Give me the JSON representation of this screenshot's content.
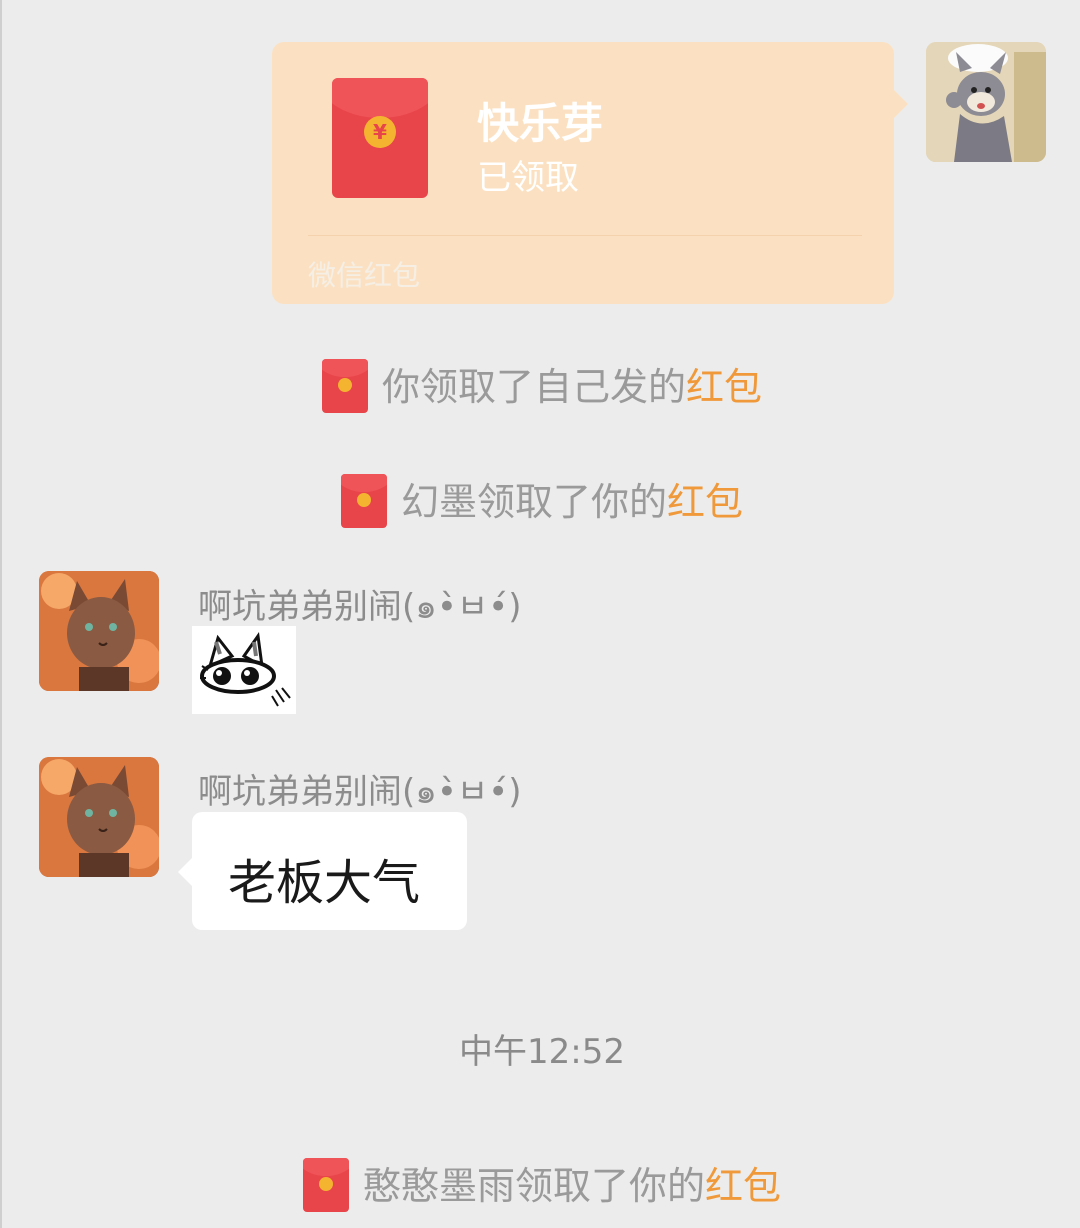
{
  "red_packet": {
    "title": "快乐芽",
    "status": "已领取",
    "footer": "微信红包",
    "currency_symbol": "¥",
    "envelope_color": "#e8454a",
    "bubble_color": "#fbe1c2",
    "coin_color": "#f4b430"
  },
  "my_avatar": {
    "icon": "tom-cat-avatar"
  },
  "notices": [
    {
      "text": "你领取了自己发的",
      "highlight": "红包"
    },
    {
      "text": "幻墨领取了你的",
      "highlight": "红包"
    },
    {
      "text": "憨憨墨雨领取了你的",
      "highlight": "红包"
    }
  ],
  "messages": [
    {
      "sender": "啊坑弟弟别闹(๑•̀ㅂ•́)",
      "type": "sticker",
      "sticker": "cat-eyes-sticker"
    },
    {
      "sender": "啊坑弟弟别闹(๑•̀ㅂ•́)",
      "type": "text",
      "text": "老板大气"
    }
  ],
  "timestamp": "中午12:52",
  "colors": {
    "background": "#ececec",
    "highlight": "#f0993a",
    "notice_text": "#9a9a9a"
  }
}
